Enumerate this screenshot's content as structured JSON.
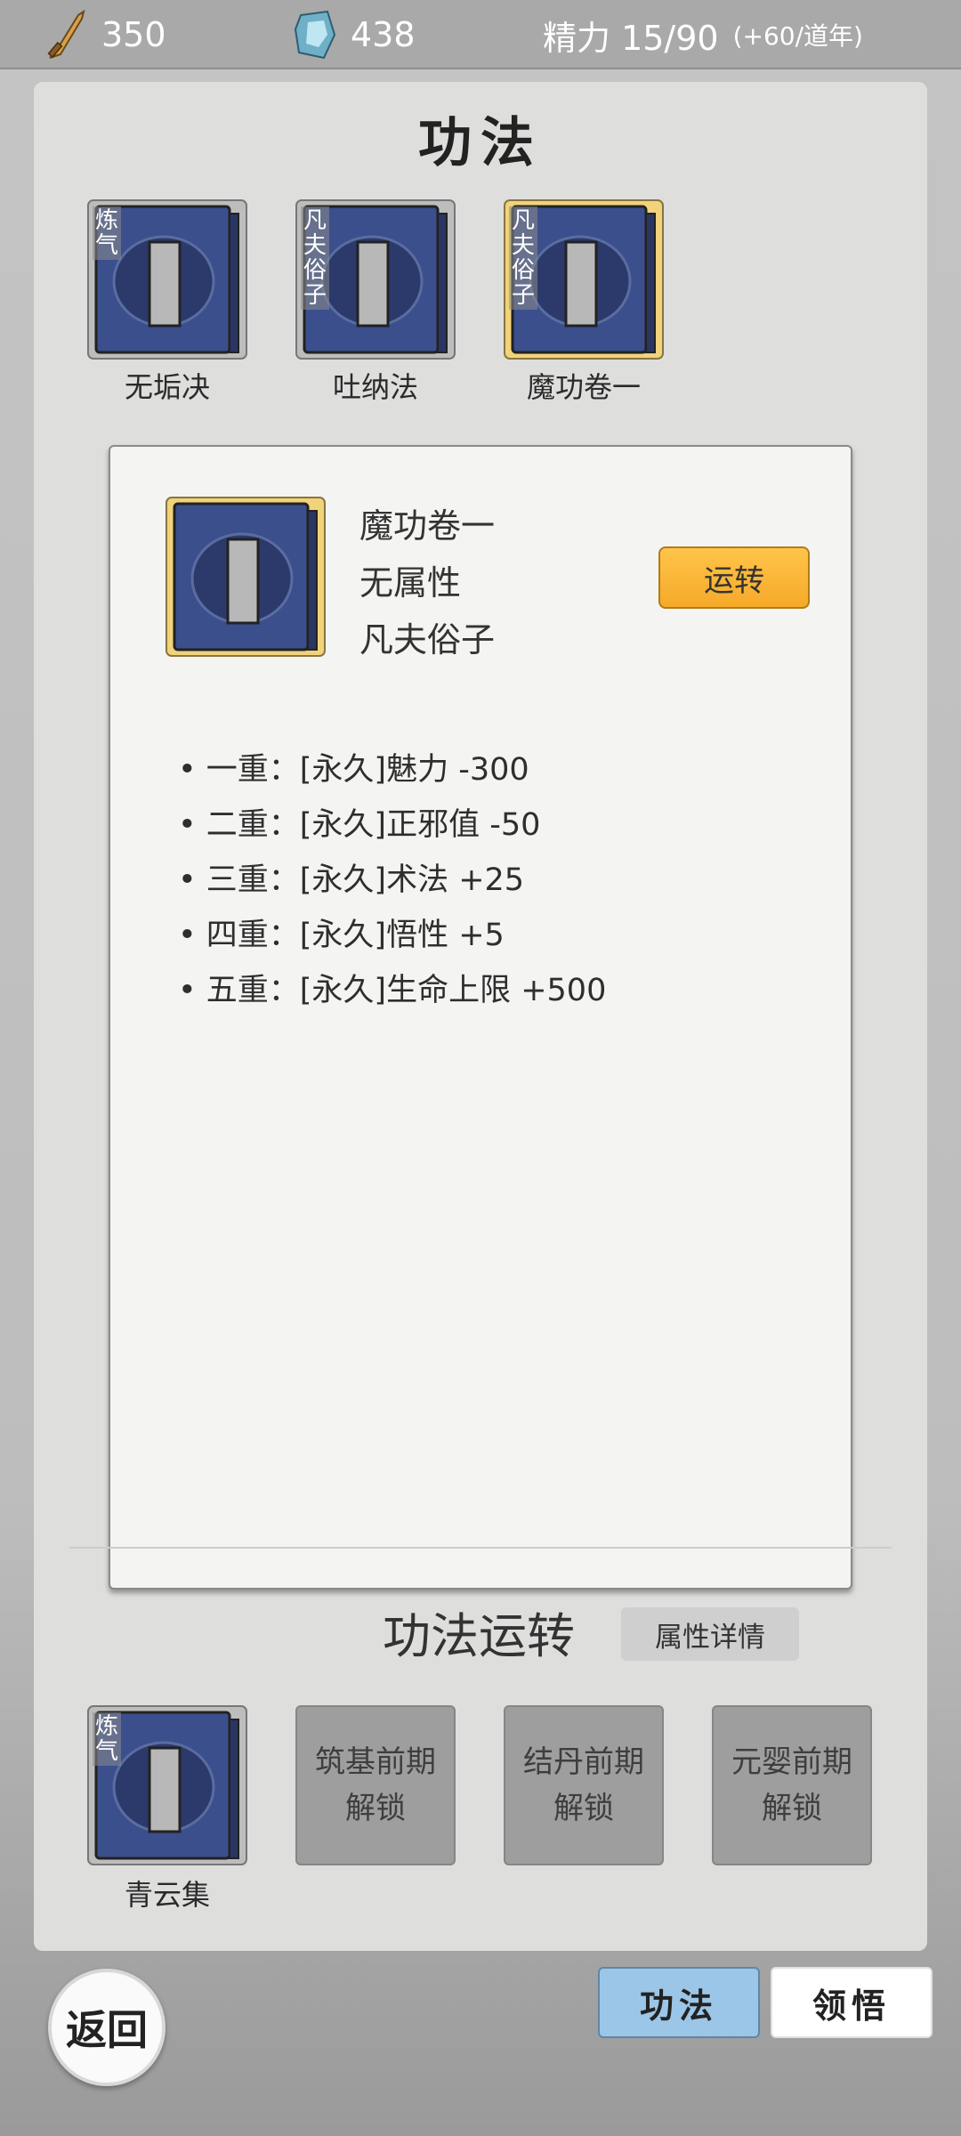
{
  "topbar": {
    "coin_icon": "sword-icon",
    "coin_value": "350",
    "stone_icon": "spirit-stone-icon",
    "stone_value": "438",
    "energy_text": "精力 15/90",
    "energy_rate": "(+60/道年)"
  },
  "panel": {
    "title": "功法",
    "books": [
      {
        "name": "无垢决",
        "tag": "炼气",
        "selected": false
      },
      {
        "name": "吐纳法",
        "tag": "凡夫俗子",
        "selected": false
      },
      {
        "name": "魔功卷一",
        "tag": "凡夫俗子",
        "selected": true
      }
    ]
  },
  "detail": {
    "name": "魔功卷一",
    "attribute": "无属性",
    "rank": "凡夫俗子",
    "run_button": "运转",
    "effects": [
      "• 一重：[永久]魅力 -300",
      "• 二重：[永久]正邪值 -50",
      "• 三重：[永久]术法 +25",
      "• 四重：[永久]悟性 +5",
      "• 五重：[永久]生命上限 +500"
    ]
  },
  "running": {
    "title": "功法运转",
    "detail_button": "属性详情",
    "active_book": {
      "name": "青云集",
      "tag": "炼气"
    },
    "locked_slots": [
      {
        "line1": "筑基前期",
        "line2": "解锁"
      },
      {
        "line1": "结丹前期",
        "line2": "解锁"
      },
      {
        "line1": "元婴前期",
        "line2": "解锁"
      }
    ]
  },
  "nav": {
    "back": "返回",
    "tab_skills": "功法",
    "tab_insight": "领悟"
  },
  "colors": {
    "accent_orange": "#f6a928",
    "tab_active": "#9cc6e8",
    "book_blue": "#3b4f8c",
    "selected_gold": "#f0d37a"
  }
}
